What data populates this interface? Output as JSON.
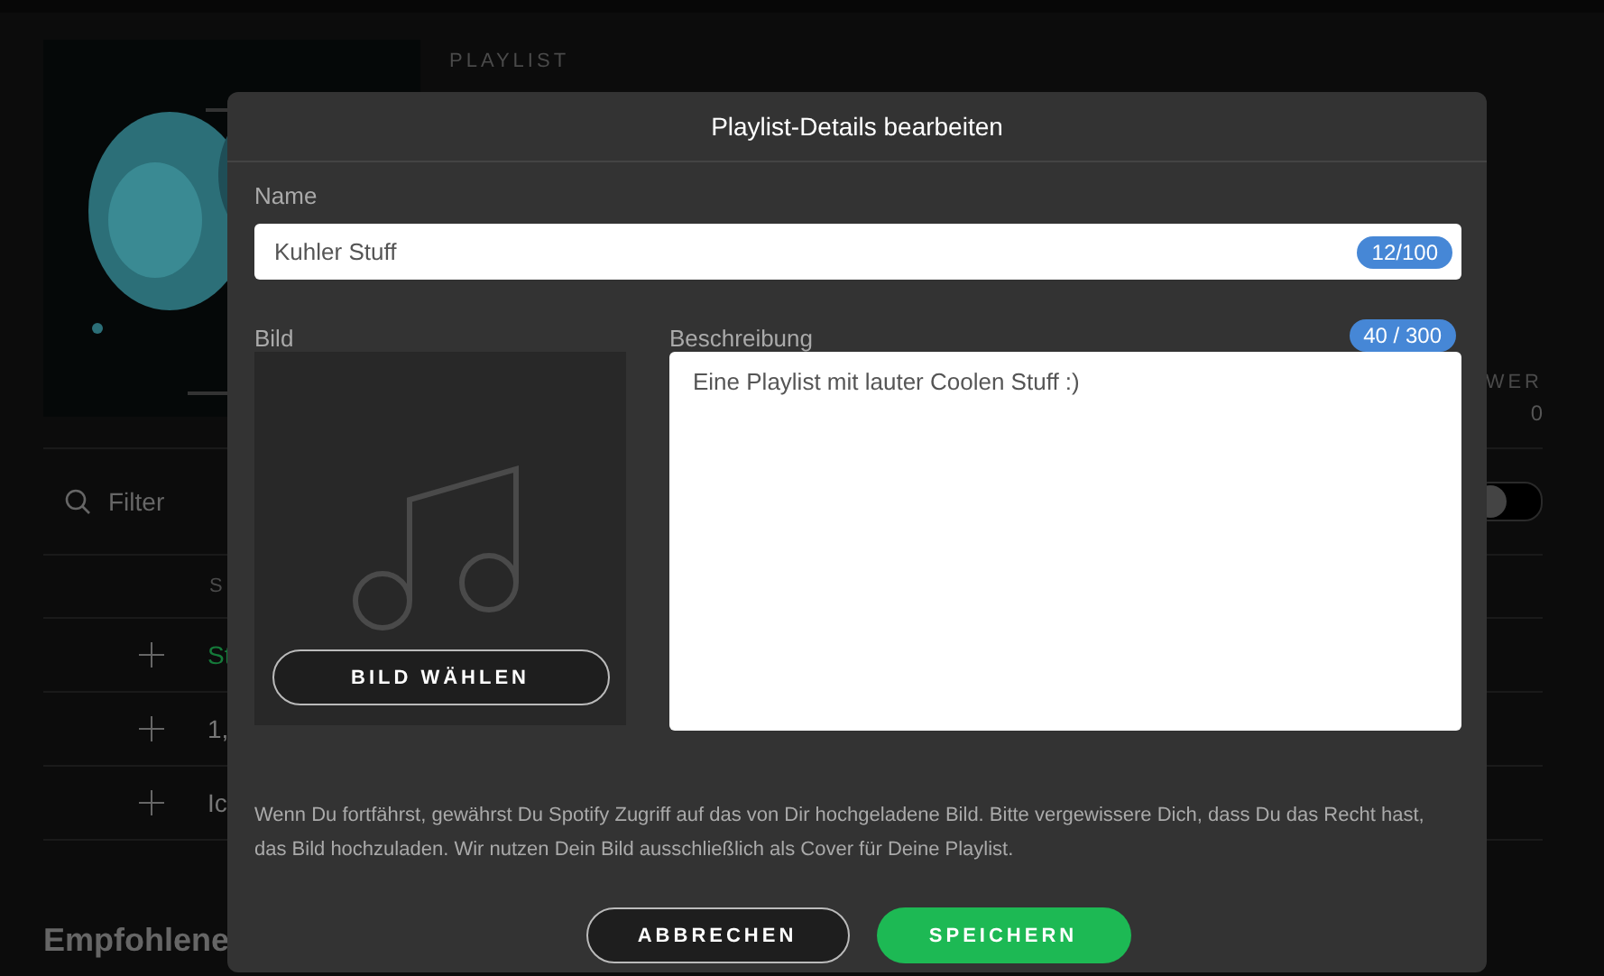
{
  "playlist_header": {
    "type_label": "PLAYLIST",
    "stat_label": "WER",
    "stat_value": "0"
  },
  "filter": {
    "placeholder": "Filter"
  },
  "toggle": {
    "on": false
  },
  "track_table": {
    "columns": [
      "S"
    ],
    "rows": [
      {
        "title": "St",
        "playing": true
      },
      {
        "title": "1,",
        "playing": false
      },
      {
        "title": "Ic",
        "playing": false
      }
    ]
  },
  "section_title": "Empfohlene",
  "dialog": {
    "title": "Playlist-Details bearbeiten",
    "name_field": {
      "label": "Name",
      "value": "Kuhler Stuff",
      "counter": "12/100"
    },
    "image": {
      "label": "Bild",
      "button": "BILD WÄHLEN"
    },
    "description_field": {
      "label": "Beschreibung",
      "value": "Eine Playlist mit lauter Coolen Stuff :)",
      "counter": "40 / 300"
    },
    "disclaimer": "Wenn Du fortfährst, gewährst Du Spotify Zugriff auf das von Dir hochgeladene Bild. Bitte vergewissere Dich, dass Du das Recht hast, das Bild hochzuladen. Wir nutzen Dein Bild ausschließlich als Cover für Deine Playlist.",
    "buttons": [
      {
        "label": "ABBRECHEN",
        "kind": "secondary"
      },
      {
        "label": "SPEICHERN",
        "kind": "primary"
      }
    ]
  }
}
